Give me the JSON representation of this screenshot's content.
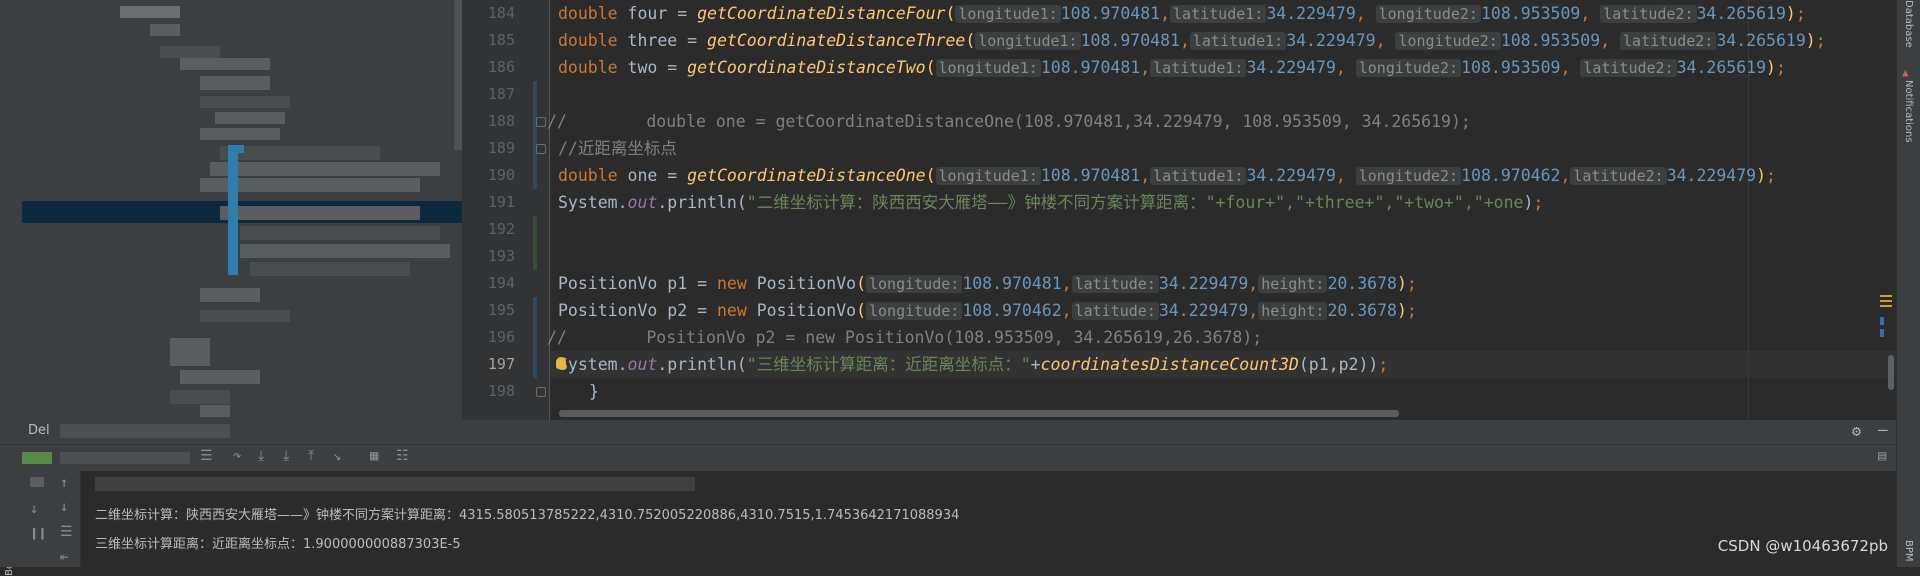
{
  "editor": {
    "lines": [
      {
        "num": "184"
      },
      {
        "num": "185"
      },
      {
        "num": "186"
      },
      {
        "num": "187"
      },
      {
        "num": "188"
      },
      {
        "num": "189"
      },
      {
        "num": "190"
      },
      {
        "num": "191"
      },
      {
        "num": "192"
      },
      {
        "num": "193"
      },
      {
        "num": "194"
      },
      {
        "num": "195"
      },
      {
        "num": "196"
      },
      {
        "num": "197"
      },
      {
        "num": "198"
      }
    ],
    "code": {
      "kw_double": "double",
      "kw_new": "new",
      "var_four": "four",
      "var_three": "three",
      "var_two": "two",
      "var_one": "one",
      "eq": " = ",
      "fn_four": "getCoordinateDistanceFour",
      "fn_three": "getCoordinateDistanceThree",
      "fn_two": "getCoordinateDistanceTwo",
      "fn_one": "getCoordinateDistanceOne",
      "hint_lon1": "longitude1:",
      "hint_lat1": "latitude1:",
      "hint_lon2": "longitude2:",
      "hint_lat2": "latitude2:",
      "hint_lon": "longitude:",
      "hint_lat": "latitude:",
      "hint_height": "height:",
      "v_108_970481": "108.970481",
      "v_34_229479": "34.229479",
      "v_108_953509": "108.953509",
      "v_34_265619": "34.265619",
      "v_108_970462": "108.970462",
      "v_20_3678": "20.3678",
      "comment_188": "//        double one = getCoordinateDistanceOne(108.970481,34.229479, 108.953509, 34.265619);",
      "comment_189": "//近距离坐标点",
      "system": "System.",
      "out": "out",
      "println": ".println(",
      "str_191": "\"二维坐标计算：陕西西安大雁塔——》钟楼不同方案计算距离：\"",
      "concat_191": "+four+\",\"+three+\",\"+two+\",\"+one",
      "position_vo": "PositionVo",
      "p1": "p1",
      "p2": "p2",
      "comment_196": "//        PositionVo p2 = new PositionVo(108.953509, 34.265619,26.3678);",
      "str_197": "\"三维坐标计算距离：近距离坐标点：\"",
      "fn_3d": "coordinatesDistanceCount3D",
      "args_3d": "(p1,p2)",
      "close_brace": "}"
    }
  },
  "right_strip": {
    "database": "Database",
    "notifications": "Notifications",
    "bpm": "BPM"
  },
  "bottom": {
    "run_title": "Del",
    "console_line1": "二维坐标计算：陕西西安大雁塔——》钟楼不同方案计算距离：4315.580513785222,4310.752005220886,4310.7515,1.7453642171088934",
    "console_line2": "三维坐标计算距离：近距离坐标点：1.900000000887303E-5",
    "bookmarks": "Bookmarks",
    "watermark": "CSDN @w10463672pb"
  },
  "colors": {
    "editor_bg": "#2b2b2b",
    "keyword": "#cc7832",
    "function": "#ffc66d",
    "number": "#6897bb",
    "string": "#6a8759",
    "comment": "#808080"
  }
}
